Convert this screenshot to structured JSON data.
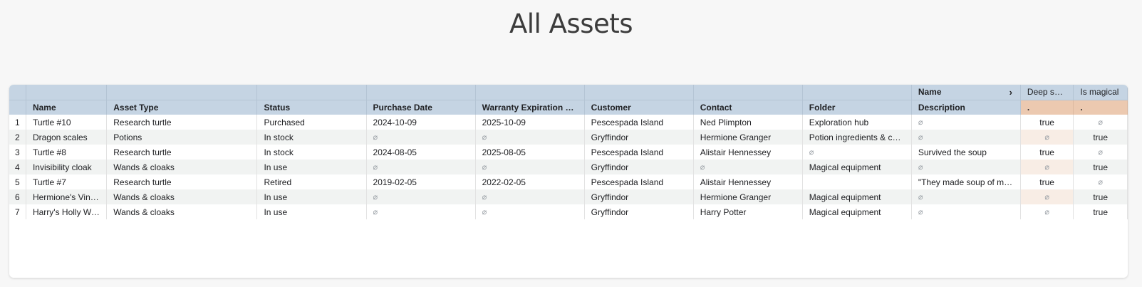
{
  "page": {
    "title": "All Assets"
  },
  "table": {
    "group_headers": {
      "name_group": "Name",
      "deep_sea": "Deep sea?",
      "is_magical": "Is magical"
    },
    "columns": [
      {
        "key": "num",
        "label": ""
      },
      {
        "key": "name",
        "label": "Name"
      },
      {
        "key": "asset_type",
        "label": "Asset Type"
      },
      {
        "key": "status",
        "label": "Status"
      },
      {
        "key": "purchase_date",
        "label": "Purchase Date"
      },
      {
        "key": "warranty",
        "label": "Warranty Expiration Date"
      },
      {
        "key": "customer",
        "label": "Customer"
      },
      {
        "key": "contact",
        "label": "Contact"
      },
      {
        "key": "folder",
        "label": "Folder"
      },
      {
        "key": "description",
        "label": "Description"
      },
      {
        "key": "deep_sea",
        "label": "."
      },
      {
        "key": "is_magical",
        "label": "."
      }
    ],
    "null_symbol": "⌀",
    "rows": [
      {
        "num": "1",
        "name": "Turtle #10",
        "asset_type": "Research turtle",
        "status": "Purchased",
        "purchase_date": "2024-10-09",
        "warranty": "2025-10-09",
        "customer": "Pescespada Island",
        "contact": "Ned Plimpton",
        "folder": "Exploration hub",
        "description": "⌀",
        "deep_sea": "true",
        "is_magical": "⌀"
      },
      {
        "num": "2",
        "name": "Dragon scales",
        "asset_type": "Potions",
        "status": "In stock",
        "purchase_date": "⌀",
        "warranty": "⌀",
        "customer": "Gryffindor",
        "contact": "Hermione Granger",
        "folder": "Potion ingredients & co…",
        "description": "⌀",
        "deep_sea": "⌀",
        "is_magical": "true"
      },
      {
        "num": "3",
        "name": "Turtle #8",
        "asset_type": "Research turtle",
        "status": "In stock",
        "purchase_date": "2024-08-05",
        "warranty": "2025-08-05",
        "customer": "Pescespada Island",
        "contact": "Alistair Hennessey",
        "folder": "⌀",
        "description": "Survived the soup",
        "deep_sea": "true",
        "is_magical": "⌀"
      },
      {
        "num": "4",
        "name": "Invisibility cloak",
        "asset_type": "Wands & cloaks",
        "status": "In use",
        "purchase_date": "⌀",
        "warranty": "⌀",
        "customer": "Gryffindor",
        "contact": "⌀",
        "folder": "Magical equipment",
        "description": "⌀",
        "deep_sea": "⌀",
        "is_magical": "true"
      },
      {
        "num": "5",
        "name": "Turtle #7",
        "asset_type": "Research turtle",
        "status": "Retired",
        "purchase_date": "2019-02-05",
        "warranty": "2022-02-05",
        "customer": "Pescespada Island",
        "contact": "Alistair Hennessey",
        "folder": "",
        "description": "\"They made soup of my…",
        "deep_sea": "true",
        "is_magical": "⌀"
      },
      {
        "num": "6",
        "name": "Hermione's Vine…",
        "asset_type": "Wands & cloaks",
        "status": "In use",
        "purchase_date": "⌀",
        "warranty": "⌀",
        "customer": "Gryffindor",
        "contact": "Hermione Granger",
        "folder": "Magical equipment",
        "description": "⌀",
        "deep_sea": "⌀",
        "is_magical": "true"
      },
      {
        "num": "7",
        "name": "Harry's Holly Wa…",
        "asset_type": "Wands & cloaks",
        "status": "In use",
        "purchase_date": "⌀",
        "warranty": "⌀",
        "customer": "Gryffindor",
        "contact": "Harry Potter",
        "folder": "Magical equipment",
        "description": "⌀",
        "deep_sea": "⌀",
        "is_magical": "true"
      }
    ]
  },
  "colors": {
    "header_bg": "#c5d4e3",
    "summary_header_bg": "#ecc9b0",
    "zebra_row": "#f1f3f2",
    "summary_zebra": "#f8ede5"
  },
  "icons": {
    "expand_group": "chevron-right-icon"
  }
}
